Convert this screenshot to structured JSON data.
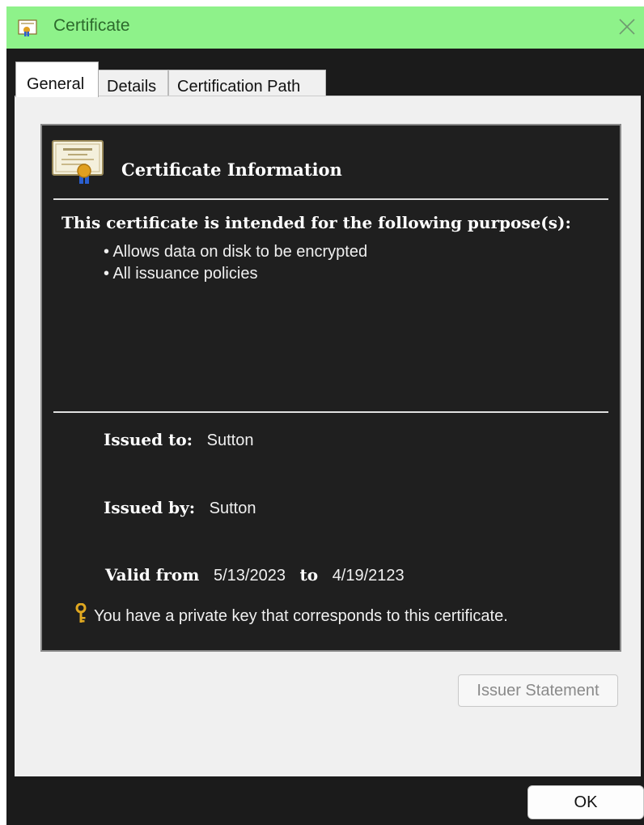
{
  "window": {
    "title": "Certificate",
    "title_icon": "certificate-icon",
    "close_icon": "close-icon",
    "titlebar_color": "#8ef28a"
  },
  "tabs": [
    {
      "label": "General",
      "selected": true
    },
    {
      "label": "Details",
      "selected": false
    },
    {
      "label": "Certification Path",
      "selected": false
    }
  ],
  "info": {
    "heading": "Certificate Information",
    "purpose_heading": "This certificate is intended for the following purpose(s):",
    "purposes": [
      "Allows data on disk to be encrypted",
      "All issuance policies"
    ],
    "issued_to_label": "Issued to:",
    "issued_to_value": "Sutton",
    "issued_by_label": "Issued by:",
    "issued_by_value": "Sutton",
    "valid_from_label": "Valid from",
    "valid_from_value": "5/13/2023",
    "valid_to_label": "to",
    "valid_to_value": "4/19/2123",
    "private_key_icon": "key-icon",
    "private_key_note": "You have a private key that corresponds to this certificate."
  },
  "buttons": {
    "issuer_statement": "Issuer Statement",
    "ok": "OK"
  }
}
